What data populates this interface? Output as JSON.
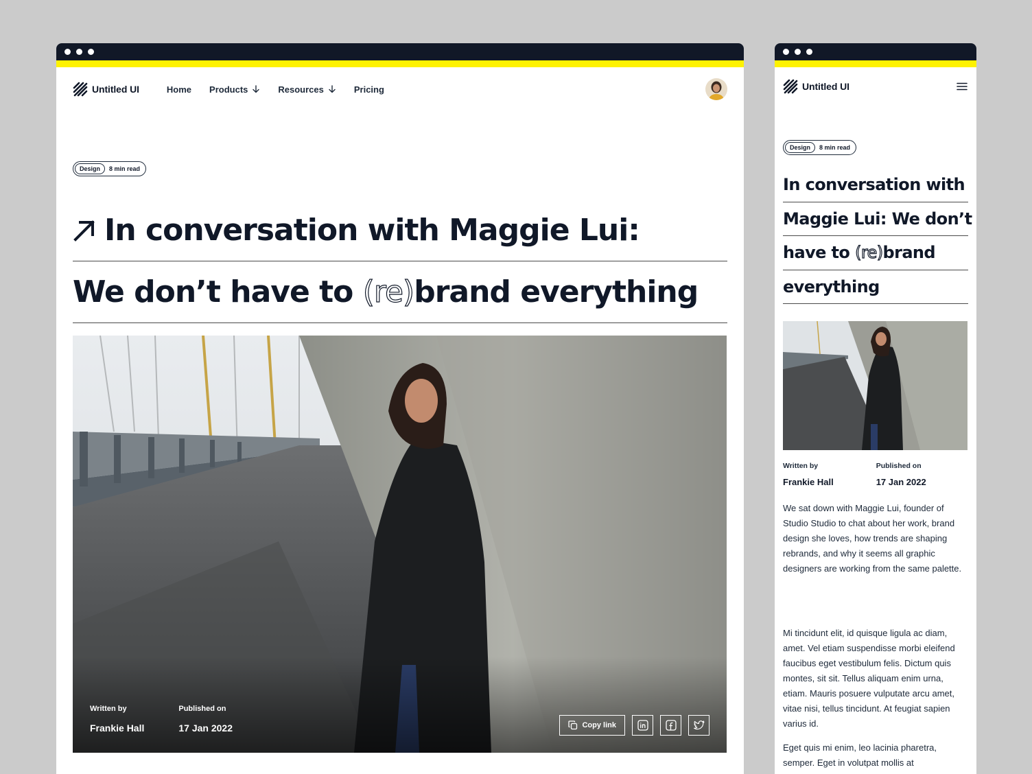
{
  "brand": {
    "name": "Untitled UI"
  },
  "nav": {
    "home": "Home",
    "products": "Products",
    "resources": "Resources",
    "pricing": "Pricing"
  },
  "article": {
    "tag": "Design",
    "read_time": "8 min read",
    "title_line1": "In conversation with Maggie Lui:",
    "title_line2_pre": "We don’t have to ",
    "title_outline": "(re)",
    "title_line2_post": "brand everything",
    "mobile_lines": [
      "In conversation with",
      "Maggie Lui: We don’t",
      "have to ",
      "brand",
      "everything"
    ],
    "written_by_label": "Written by",
    "author": "Frankie Hall",
    "published_label": "Published on",
    "date": "17 Jan 2022",
    "intro": "We sat down with Maggie Lui, founder of Studio Studio to chat about her work, brand design she loves, how trends are shaping rebrands, and why it seems all graphic designers are working from the same palette.",
    "body1": "Mi tincidunt elit, id quisque ligula ac diam, amet. Vel etiam suspendisse morbi eleifend faucibus eget vestibulum felis. Dictum quis montes, sit sit. Tellus aliquam enim urna, etiam. Mauris posuere vulputate arcu amet, vitae nisi, tellus tincidunt. At feugiat sapien varius id.",
    "body2": "Eget quis mi enim, leo lacinia pharetra, semper. Eget in volutpat mollis at"
  },
  "share": {
    "copy_label": "Copy link"
  },
  "colors": {
    "accent": "#fef200",
    "titlebar": "#111827",
    "text": "#101828"
  }
}
